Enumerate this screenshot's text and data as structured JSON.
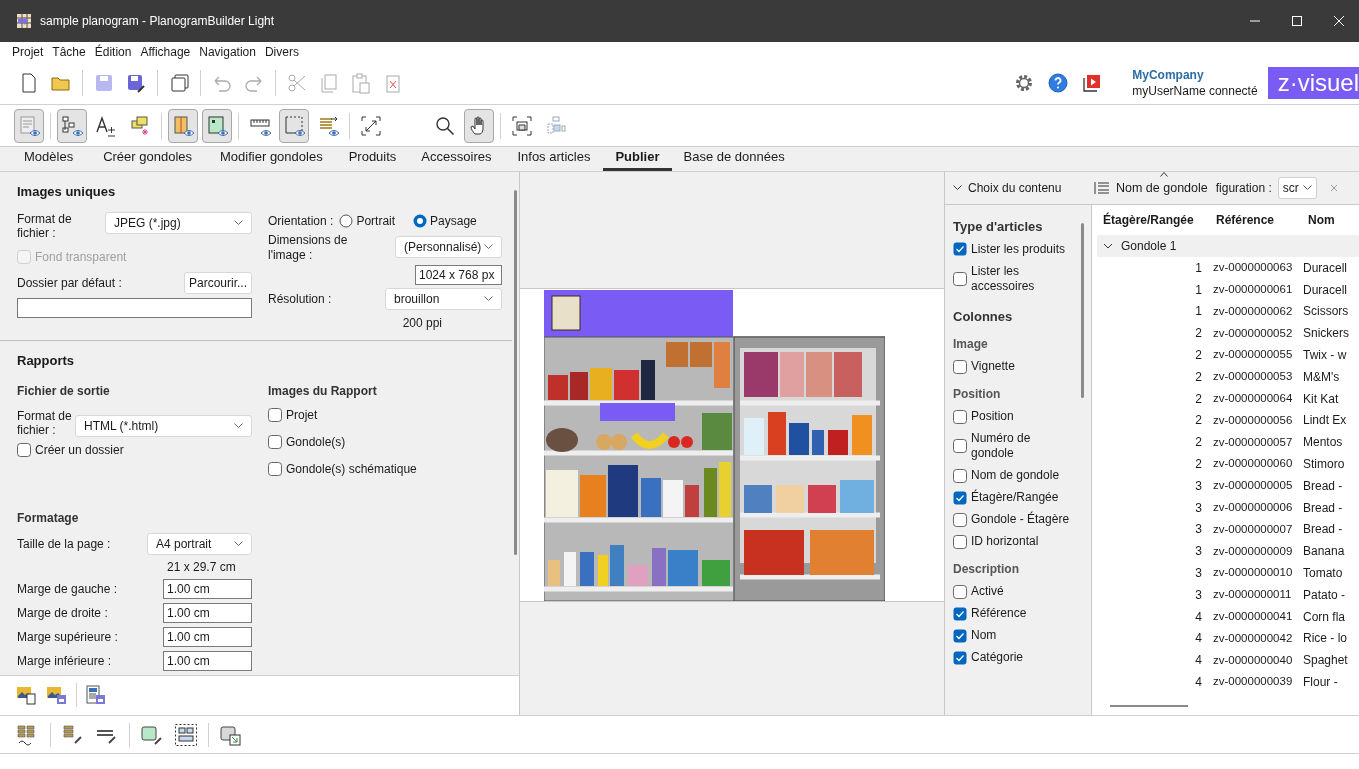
{
  "window": {
    "title": "sample planogram - PlanogramBuilder Light"
  },
  "menu": [
    "Projet",
    "Tâche",
    "Édition",
    "Affichage",
    "Navigation",
    "Divers"
  ],
  "account": {
    "company": "MyCompany",
    "user": "myUserName connecté",
    "logo": "z·visuel"
  },
  "toolbar_2": [
    {
      "pressed": true
    },
    {
      "pressed": true
    },
    {
      "pressed": false
    },
    {
      "pressed": false
    },
    {
      "pressed": true
    },
    {
      "pressed": true
    },
    {
      "pressed": false
    },
    {
      "pressed": true
    },
    {
      "pressed": false
    },
    {
      "pressed": false
    },
    {
      "pressed": false
    },
    {
      "pressed": true
    },
    {
      "pressed": false
    },
    {
      "pressed": false
    }
  ],
  "tabs": [
    {
      "label": "Modèles",
      "selected": false
    },
    {
      "label": "Créer gondoles",
      "selected": false
    },
    {
      "label": "Modifier gondoles",
      "selected": false
    },
    {
      "label": "Produits",
      "selected": false
    },
    {
      "label": "Accessoires",
      "selected": false
    },
    {
      "label": "Infos articles",
      "selected": false
    },
    {
      "label": "Publier",
      "selected": true
    },
    {
      "label": "Base de données",
      "selected": false
    }
  ],
  "single_images": {
    "title": "Images uniques",
    "format_label": "Format de fichier :",
    "format_value": "JPEG (*.jpg)",
    "transparent": {
      "label": "Fond transparent",
      "checked": false,
      "disabled": true
    },
    "folder_label": "Dossier par défaut :",
    "browse_button": "Parcourir...",
    "orientation_label": "Orientation :",
    "orientations": [
      {
        "label": "Portrait",
        "selected": false
      },
      {
        "label": "Paysage",
        "selected": true
      }
    ],
    "dimensions_label": "Dimensions de l'image :",
    "dimensions_value": "(Personnalisé)",
    "size_value": "1024 x 768 px",
    "resolution_label": "Résolution :",
    "resolution_value": "brouillon",
    "ppi": "200 ppi"
  },
  "reports": {
    "title": "Rapports",
    "output_title": "Fichier de sortie",
    "format_label": "Format de fichier :",
    "format_value": "HTML (*.html)",
    "create_folder": {
      "label": "Créer un dossier",
      "checked": false
    },
    "images_title": "Images du Rapport",
    "images": [
      {
        "label": "Projet",
        "checked": false
      },
      {
        "label": "Gondole(s)",
        "checked": false
      },
      {
        "label": "Gondole(s) schématique",
        "checked": false
      }
    ],
    "formatting_title": "Formatage",
    "page_size_label": "Taille de la page :",
    "page_size_value": "A4 portrait",
    "page_dims": "21 x 29.7 cm",
    "margins": [
      {
        "label": "Marge de gauche :",
        "value": "1.00 cm"
      },
      {
        "label": "Marge de droite :",
        "value": "1.00 cm"
      },
      {
        "label": "Marge supérieure :",
        "value": "1.00 cm"
      },
      {
        "label": "Marge inférieure :",
        "value": "1.00 cm"
      }
    ]
  },
  "content_panel": {
    "chooser": "Choix du contenu",
    "group_by": "Nom de gondole",
    "config_label": "figuration :",
    "config_value": "scr",
    "items": [
      {
        "kind": "heading",
        "label": "Type d'articles"
      },
      {
        "kind": "checkbox",
        "label": "Lister les produits",
        "checked": true
      },
      {
        "kind": "checkbox",
        "label": "Lister les accessoires",
        "checked": false
      },
      {
        "kind": "heading",
        "label": "Colonnes"
      },
      {
        "kind": "subheading",
        "label": "Image"
      },
      {
        "kind": "checkbox",
        "label": "Vignette",
        "checked": false
      },
      {
        "kind": "subheading",
        "label": "Position"
      },
      {
        "kind": "checkbox",
        "label": "Position",
        "checked": false
      },
      {
        "kind": "checkbox",
        "label": "Numéro de gondole",
        "checked": false
      },
      {
        "kind": "checkbox",
        "label": "Nom de gondole",
        "checked": false
      },
      {
        "kind": "checkbox",
        "label": "Étagère/Rangée",
        "checked": true
      },
      {
        "kind": "checkbox",
        "label": "Gondole - Étagère",
        "checked": false
      },
      {
        "kind": "checkbox",
        "label": "ID horizontal",
        "checked": false
      },
      {
        "kind": "subheading",
        "label": "Description"
      },
      {
        "kind": "checkbox",
        "label": "Activé",
        "checked": false
      },
      {
        "kind": "checkbox",
        "label": "Référence",
        "checked": true
      },
      {
        "kind": "checkbox",
        "label": "Nom",
        "checked": true
      },
      {
        "kind": "checkbox",
        "label": "Catégorie",
        "checked": true
      }
    ]
  },
  "table": {
    "columns": [
      "Étagère/Rangée",
      "Référence",
      "Nom"
    ],
    "group": {
      "label": "Gondole 1",
      "expanded": true
    },
    "rows": [
      {
        "shelf": "1",
        "reference": "zv-0000000063",
        "name": "Duracell"
      },
      {
        "shelf": "1",
        "reference": "zv-0000000061",
        "name": "Duracell"
      },
      {
        "shelf": "1",
        "reference": "zv-0000000062",
        "name": "Scissors"
      },
      {
        "shelf": "2",
        "reference": "zv-0000000052",
        "name": "Snickers"
      },
      {
        "shelf": "2",
        "reference": "zv-0000000055",
        "name": "Twix - w"
      },
      {
        "shelf": "2",
        "reference": "zv-0000000053",
        "name": "M&M's"
      },
      {
        "shelf": "2",
        "reference": "zv-0000000064",
        "name": "Kit Kat"
      },
      {
        "shelf": "2",
        "reference": "zv-0000000056",
        "name": "Lindt Ex"
      },
      {
        "shelf": "2",
        "reference": "zv-0000000057",
        "name": "Mentos"
      },
      {
        "shelf": "2",
        "reference": "zv-0000000060",
        "name": "Stimoro"
      },
      {
        "shelf": "3",
        "reference": "zv-0000000005",
        "name": "Bread -"
      },
      {
        "shelf": "3",
        "reference": "zv-0000000006",
        "name": "Bread -"
      },
      {
        "shelf": "3",
        "reference": "zv-0000000007",
        "name": "Bread -"
      },
      {
        "shelf": "3",
        "reference": "zv-0000000009",
        "name": "Banana"
      },
      {
        "shelf": "3",
        "reference": "zv-0000000010",
        "name": "Tomato"
      },
      {
        "shelf": "3",
        "reference": "zv-0000000011",
        "name": "Patato -"
      },
      {
        "shelf": "4",
        "reference": "zv-0000000041",
        "name": "Corn fla"
      },
      {
        "shelf": "4",
        "reference": "zv-0000000042",
        "name": "Rice - lo"
      },
      {
        "shelf": "4",
        "reference": "zv-0000000040",
        "name": "Spaghet"
      },
      {
        "shelf": "4",
        "reference": "zv-0000000039",
        "name": "Flour -"
      }
    ]
  }
}
